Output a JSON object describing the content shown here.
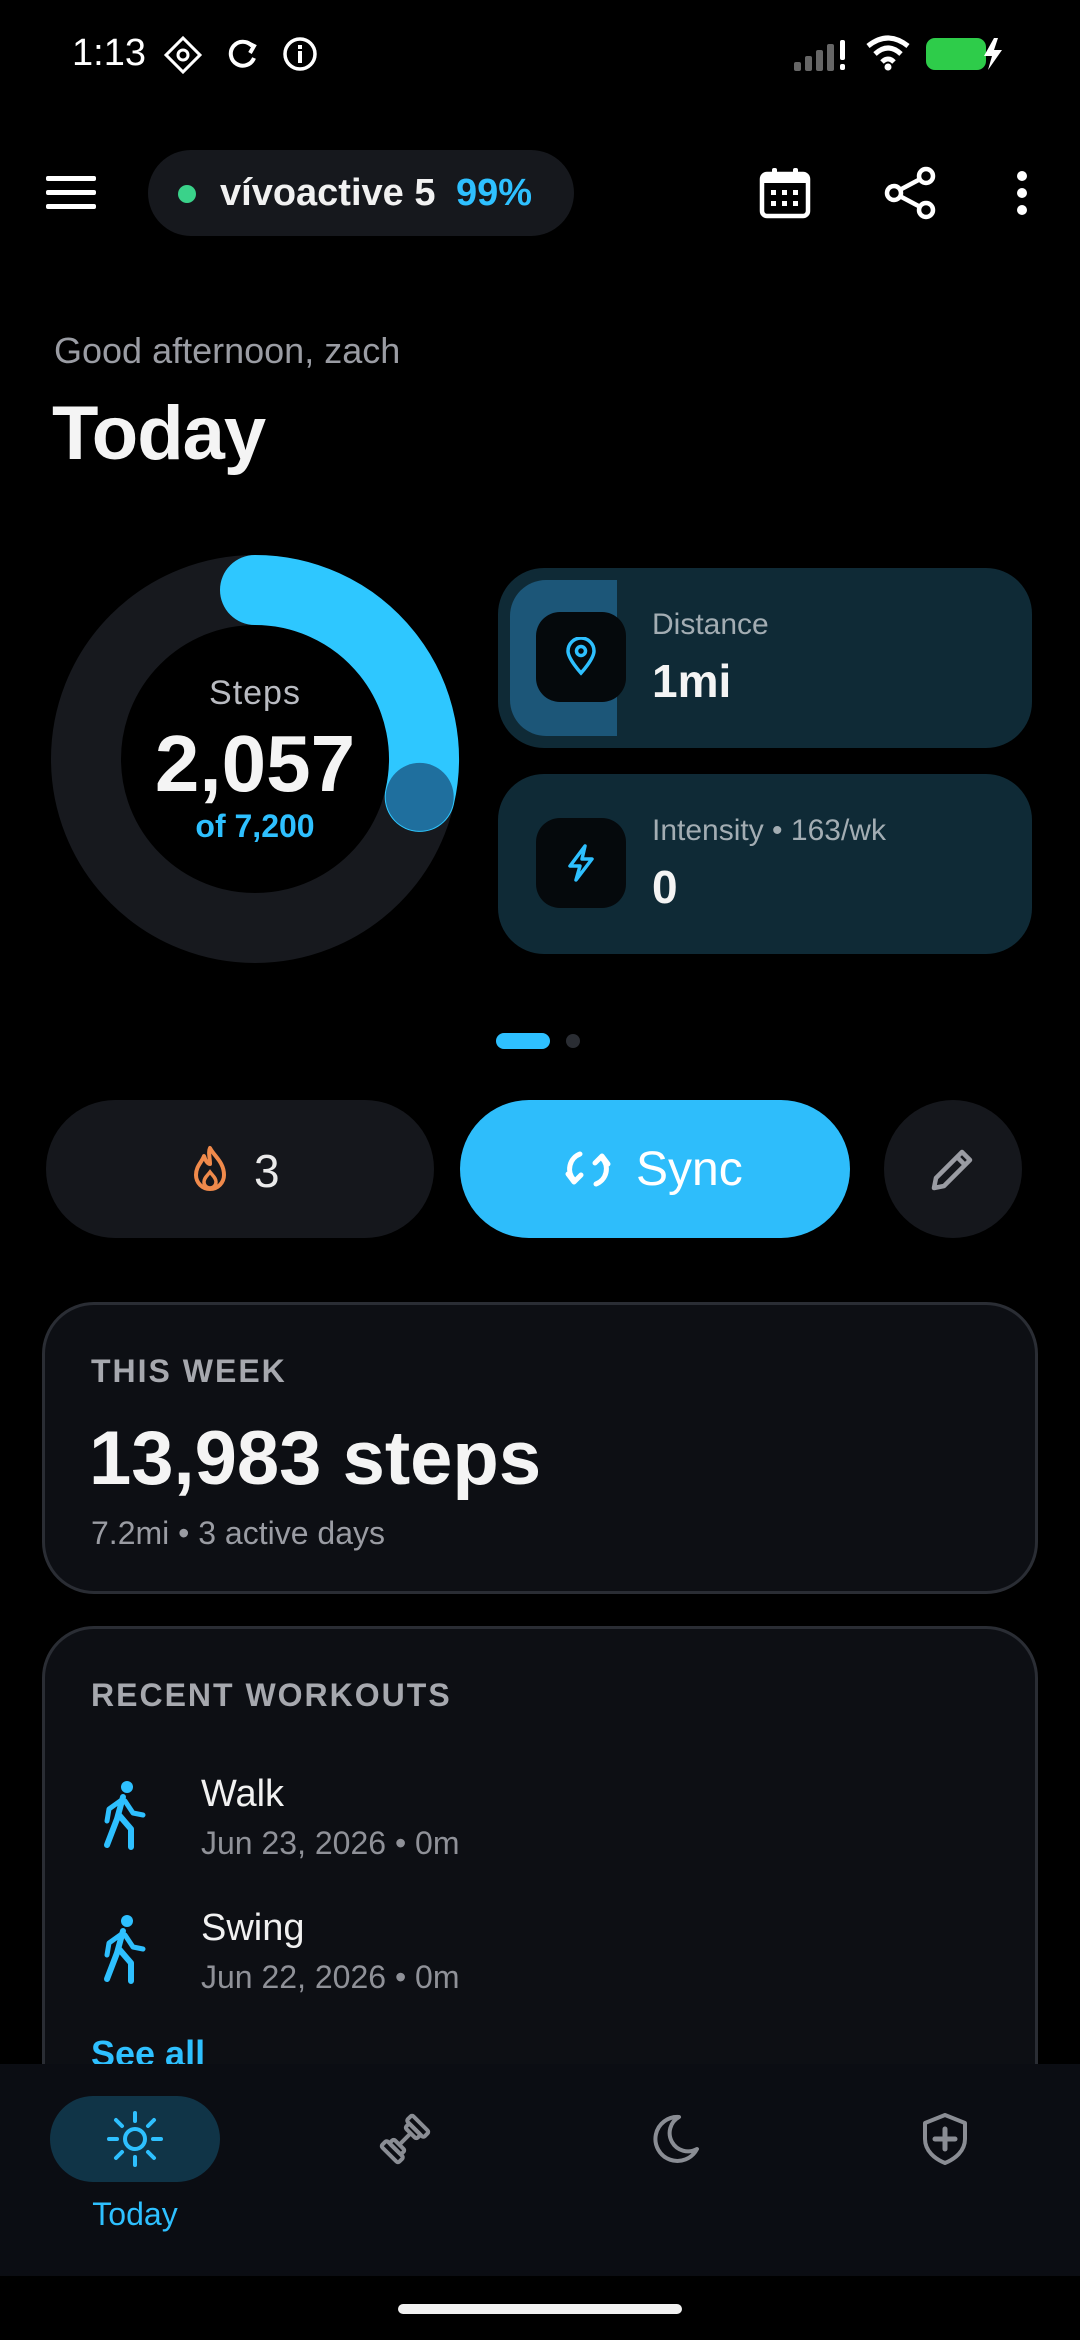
{
  "status_bar": {
    "time": "1:13"
  },
  "header": {
    "device_name": "vívoactive 5",
    "battery": "99%",
    "icons": [
      "menu-icon",
      "calendar-icon",
      "share-icon",
      "more-vert-icon"
    ]
  },
  "greeting": "Good afternoon, zach",
  "title": "Today",
  "steps": {
    "label": "Steps",
    "value": "2,057",
    "goal_text": "of 7,200",
    "progress_fraction": 0.286
  },
  "metrics": [
    {
      "label": "Distance",
      "value": "1mi",
      "icon": "location-pin-icon",
      "progress_fraction": 0.2
    },
    {
      "label": "Intensity • 163/wk",
      "value": "0",
      "icon": "lightning-icon",
      "progress_fraction": 0
    }
  ],
  "actions": {
    "streak_count": "3",
    "sync_label": "Sync"
  },
  "this_week": {
    "title": "THIS WEEK",
    "value": "13,983 steps",
    "sub": "7.2mi • 3 active days"
  },
  "recent_workouts": {
    "title": "RECENT WORKOUTS",
    "items": [
      {
        "name": "Walk",
        "meta": "Jun 23, 2026 • 0m",
        "icon": "walk-icon"
      },
      {
        "name": "Swing",
        "meta": "Jun 22, 2026 • 0m",
        "icon": "walk-icon"
      }
    ],
    "see_all": "See all"
  },
  "bottom_nav": {
    "items": [
      {
        "label": "Today",
        "icon": "sun-icon",
        "active": true
      },
      {
        "label": "",
        "icon": "dumbbell-icon",
        "active": false
      },
      {
        "label": "",
        "icon": "moon-icon",
        "active": false
      },
      {
        "label": "",
        "icon": "shield-plus-icon",
        "active": false
      }
    ]
  },
  "colors": {
    "accent": "#2ec0ff",
    "background": "#000000",
    "card": "#0d0f14",
    "metric_card": "#0f2a36",
    "streak_flame": "#f08a4b",
    "online_dot": "#3ad28a"
  }
}
